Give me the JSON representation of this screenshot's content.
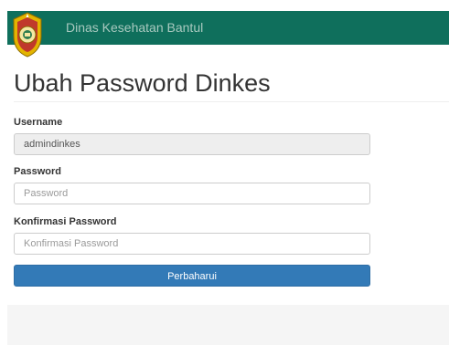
{
  "header": {
    "brand": "Dinas Kesehatan Bantul",
    "logo_icon": "crest-emblem-icon",
    "color": "#0f6f5c"
  },
  "page": {
    "title": "Ubah Password Dinkes"
  },
  "form": {
    "username": {
      "label": "Username",
      "value": "admindinkes"
    },
    "password": {
      "label": "Password",
      "value": "",
      "placeholder": "Password"
    },
    "confirm_password": {
      "label": "Konfirmasi Password",
      "value": "",
      "placeholder": "Konfirmasi Password"
    },
    "submit_label": "Perbaharui",
    "submit_color": "#337ab7"
  }
}
